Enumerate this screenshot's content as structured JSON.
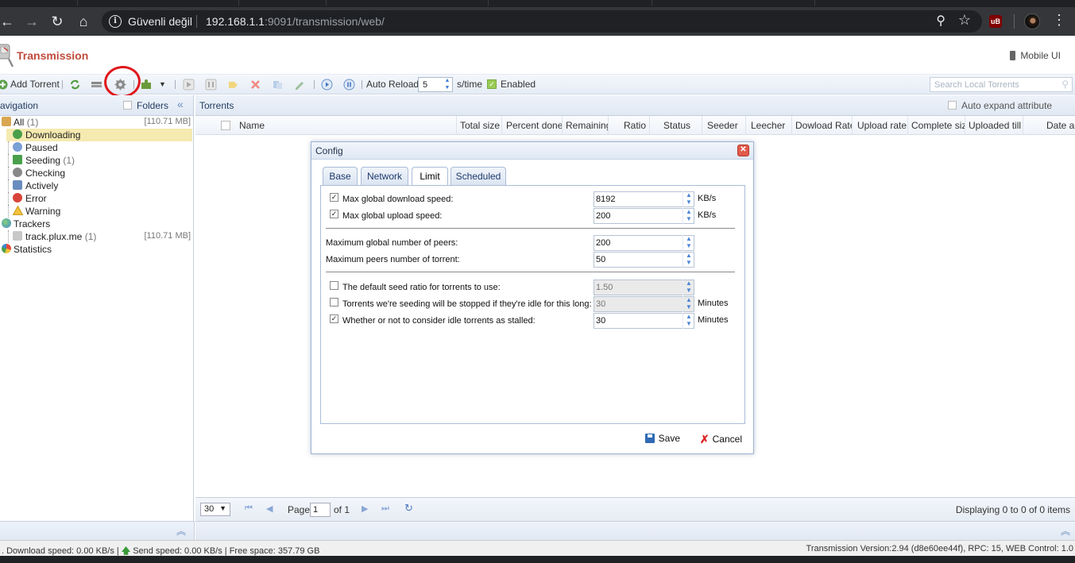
{
  "browser": {
    "security_label": "Güvenli değil",
    "url_host": "192.168.1.1",
    "url_rest": ":9091/transmission/web/"
  },
  "header": {
    "logo_text": "Transmission",
    "mobile_ui": "Mobile UI"
  },
  "toolbar": {
    "add_torrent": "Add Torrent",
    "auto_reload_label": "Auto Reload:",
    "auto_reload_value": "5",
    "auto_reload_unit": "s/time",
    "enabled_label": "Enabled",
    "search_placeholder": "Search Local Torrents"
  },
  "navigation": {
    "title": "avigation",
    "folders_label": "Folders",
    "items": [
      {
        "label": "All",
        "count": "(1)",
        "size": "[110.71 MB]"
      },
      {
        "label": "Downloading",
        "count": "",
        "size": ""
      },
      {
        "label": "Paused",
        "count": "",
        "size": ""
      },
      {
        "label": "Seeding",
        "count": "(1)",
        "size": ""
      },
      {
        "label": "Checking",
        "count": "",
        "size": ""
      },
      {
        "label": "Actively",
        "count": "",
        "size": ""
      },
      {
        "label": "Error",
        "count": "",
        "size": ""
      },
      {
        "label": "Warning",
        "count": "",
        "size": ""
      },
      {
        "label": "Trackers",
        "count": "",
        "size": ""
      },
      {
        "label": "track.plux.me",
        "count": "(1)",
        "size": "[110.71 MB]"
      },
      {
        "label": "Statistics",
        "count": "",
        "size": ""
      }
    ]
  },
  "torrents": {
    "title": "Torrents",
    "auto_expand": "Auto expand attribute",
    "columns": [
      "Name",
      "Total size",
      "Percent done",
      "Remaining",
      "Ratio",
      "Status",
      "Seeder",
      "Leecher",
      "Dowload Rate",
      "Upload rate",
      "Complete size",
      "Uploaded till d",
      "Date ac"
    ]
  },
  "pager": {
    "page_size": "30",
    "page_label": "Page",
    "page_value": "1",
    "of_label": "of 1",
    "displaying": "Displaying 0 to 0 of 0 items"
  },
  "status": {
    "download": ". Download speed: 0.00 KB/s |",
    "send": "Send speed: 0.00 KB/s | Free space: 357.79 GB",
    "version": "Transmission Version:2.94 (d8e60ee44f), RPC: 15, WEB Control: 1.0"
  },
  "dialog": {
    "title": "Config",
    "tabs": [
      "Base",
      "Network",
      "Limit",
      "Scheduled"
    ],
    "active_tab": "Limit",
    "rows": [
      {
        "label": "Max global download speed:",
        "checked": true,
        "value": "8192",
        "unit": "KB/s",
        "disabled": false
      },
      {
        "label": "Max global upload speed:",
        "checked": true,
        "value": "200",
        "unit": "KB/s",
        "disabled": false
      },
      {
        "label": "Maximum global number of peers:",
        "checked": null,
        "value": "200",
        "unit": "",
        "disabled": false
      },
      {
        "label": "Maximum peers number of torrent:",
        "checked": null,
        "value": "50",
        "unit": "",
        "disabled": false
      },
      {
        "label": "The default seed ratio for torrents to use:",
        "checked": false,
        "value": "1.50",
        "unit": "",
        "disabled": true
      },
      {
        "label": "Torrents we're seeding will be stopped if they're idle for this long:",
        "checked": false,
        "value": "30",
        "unit": "Minutes",
        "disabled": true
      },
      {
        "label": "Whether or not to consider idle torrents as stalled:",
        "checked": true,
        "value": "30",
        "unit": "Minutes",
        "disabled": false
      }
    ],
    "save_label": "Save",
    "cancel_label": "Cancel"
  }
}
